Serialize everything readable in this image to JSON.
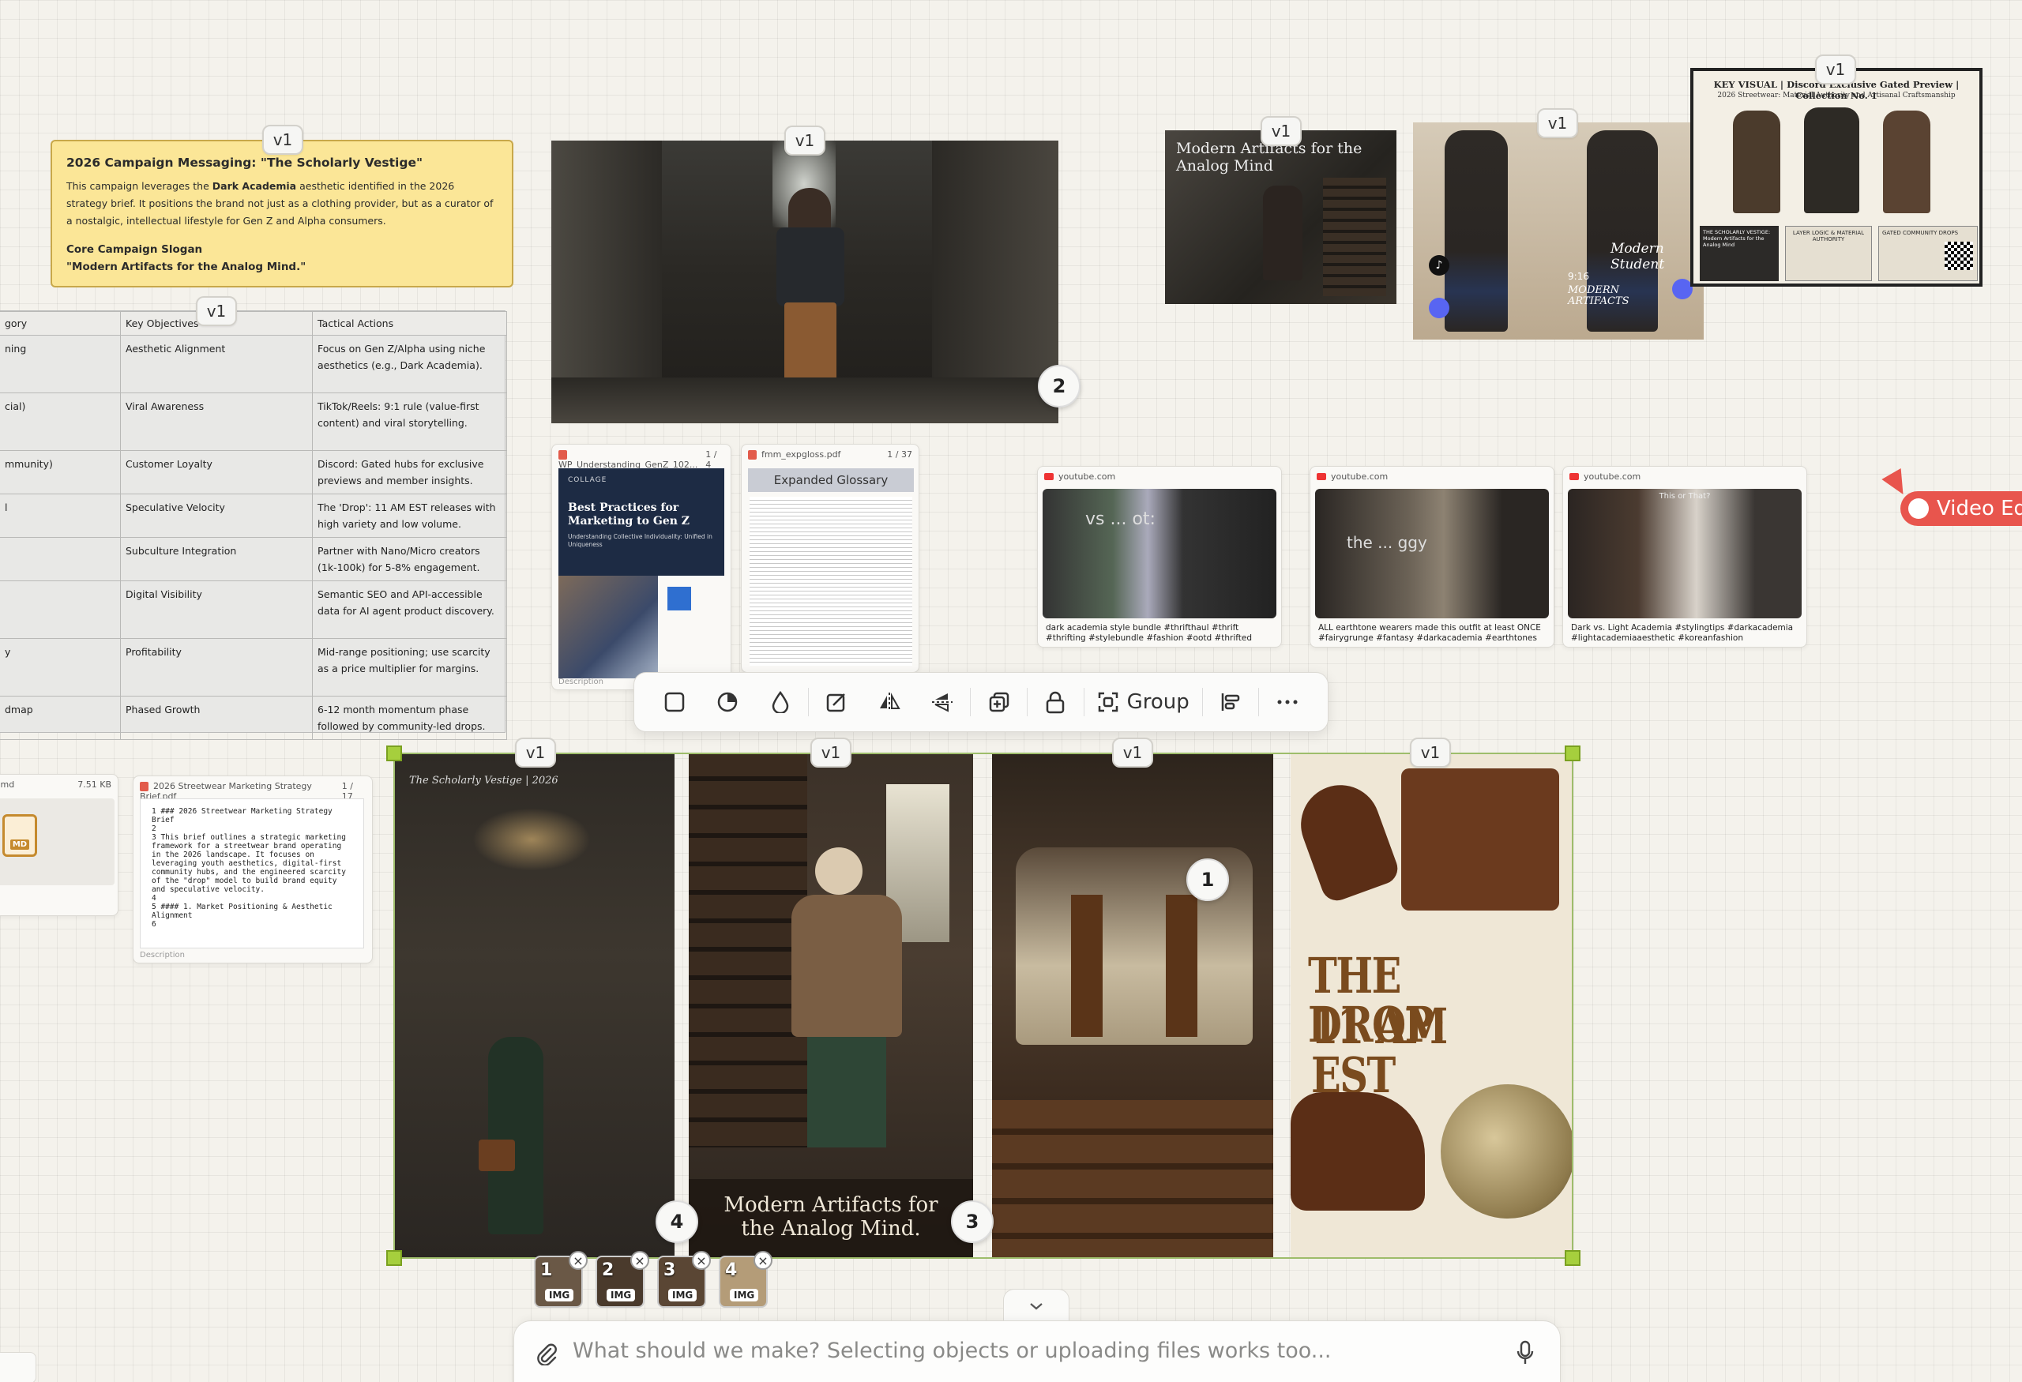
{
  "note": {
    "title": "2026 Campaign Messaging: \"The Scholarly Vestige\"",
    "body_pre": "This campaign leverages the ",
    "body_bold": "Dark Academia",
    "body_post": " aesthetic identified in the 2026 strategy brief. It positions the brand not just as a clothing provider, but as a curator of a nostalgic, intellectual lifestyle for Gen Z and Alpha consumers.",
    "slogan_label": "Core Campaign Slogan",
    "slogan": "\"Modern Artifacts for the Analog Mind.\""
  },
  "version_label": "v1",
  "table": {
    "headers": [
      "gory",
      "Key Objectives",
      "Tactical Actions"
    ],
    "rows": [
      [
        "ning",
        "Aesthetic Alignment",
        "Focus on Gen Z/Alpha using niche aesthetics (e.g., Dark Academia)."
      ],
      [
        "cial)",
        "Viral Awareness",
        "TikTok/Reels: 9:1 rule (value-first content) and viral storytelling."
      ],
      [
        "mmunity)",
        "Customer Loyalty",
        "Discord: Gated hubs for exclusive previews and member insights."
      ],
      [
        "l",
        "Speculative Velocity",
        "The 'Drop': 11 AM EST releases with high variety and low volume."
      ],
      [
        "",
        "Subculture Integration",
        "Partner with Nano/Micro creators (1k-100k) for 5-8% engagement."
      ],
      [
        "",
        "Digital Visibility",
        "Semantic SEO and API-accessible data for AI agent product discovery."
      ],
      [
        "y",
        "Profitability",
        "Mid-range positioning; use scarcity as a price multiplier for margins."
      ],
      [
        "dmap",
        "Phased Growth",
        "6-12 month momentum phase followed by community-led drops."
      ]
    ]
  },
  "library_image_badge": "2",
  "docs": {
    "doc1": {
      "name": "WP_Understanding_GenZ_102...",
      "pages": "1 / 4",
      "brand": "COLLAGE",
      "title": "Best Practices for Marketing to Gen Z",
      "subtitle": "Understanding Collective Individuality: Unified in Uniqueness",
      "desc": "Description"
    },
    "doc2": {
      "name": "fmm_expgloss.pdf",
      "pages": "1 / 37",
      "title": "Expanded Glossary"
    },
    "md_file": {
      "name": ".md",
      "size": "7.51 KB",
      "icon_label": "MD"
    },
    "brief": {
      "name": "2026 Streetwear Marketing Strategy Brief.pdf",
      "pages": "1 / 17",
      "lines": [
        "1  ### 2026 Streetwear Marketing Strategy Brief",
        "2",
        "3  This brief outlines a strategic marketing framework for a streetwear brand operating in the 2026 landscape. It focuses on leveraging youth aesthetics, digital-first community hubs, and the engineered scarcity of the \"drop\" model to build brand equity and speculative velocity.",
        "4",
        "5  #### 1. Market Positioning & Aesthetic Alignment",
        "6"
      ],
      "desc": "Description"
    }
  },
  "top_images": {
    "poster_text": "Modern Artifacts for the Analog Mind",
    "lookbook_overlay": "Modern Student",
    "lookbook_date": "9:16",
    "lookbook_brand": "MODERN ARTIFACTS",
    "keyvisual_title": "KEY VISUAL | Discord Exclusive Gated Preview | Collection No. 1",
    "keyvisual_sub": "2026 Streetwear: Material Authority and Artisanal Craftsmanship",
    "keyvisual_labels": [
      "THE SCHOLARLY VESTIGE: Modern Artifacts for the Analog Mind",
      "LAYER LOGIC & MATERIAL AUTHORITY",
      "GATED COMMUNITY DROPS"
    ]
  },
  "youtube": [
    {
      "site": "youtube.com",
      "caption": "dark academia style bundle #thrifthaul #thrift #thrifting #stylebundle #fashion #ootd #thrifted",
      "overlay": "vs ... ot:"
    },
    {
      "site": "youtube.com",
      "caption": "ALL earthtone wearers made this outfit at least ONCE #fairygrunge #fantasy #darkacademia #earthtones",
      "overlay": "the ... ggy"
    },
    {
      "site": "youtube.com",
      "caption": "Dark vs. Light Academia #stylingtips #darkacademia #lightacademiaaesthetic #koreanfashion",
      "overlay": "This or That?"
    }
  ],
  "toolbar": {
    "group_label": "Group",
    "tools": [
      "square-icon",
      "pie-icon",
      "drop-icon",
      "edit-icon",
      "flip-h-icon",
      "flip-v-icon",
      "duplicate-icon",
      "lock-icon",
      "group-icon",
      "align-icon",
      "more-icon"
    ]
  },
  "panels": {
    "p1_caption": "The Scholarly Vestige | 2026",
    "p2_caption": "Modern Artifacts for the Analog Mind.",
    "p4_headline_1": "THE DROP:",
    "p4_headline_2": "11 AM EST",
    "badges": {
      "b1": "1",
      "b3": "3",
      "b4": "4"
    }
  },
  "thumbs": [
    {
      "num": "1",
      "label": "IMG"
    },
    {
      "num": "2",
      "label": "IMG"
    },
    {
      "num": "3",
      "label": "IMG"
    },
    {
      "num": "4",
      "label": "IMG"
    }
  ],
  "chat": {
    "placeholder": "What should we make? Selecting objects or uploading files works too..."
  },
  "video_editor": {
    "label": "Video Edi"
  },
  "colors": {
    "accent_red": "#e8554d",
    "selection_green": "#a6cf3d",
    "note_yellow": "#fbe697"
  }
}
